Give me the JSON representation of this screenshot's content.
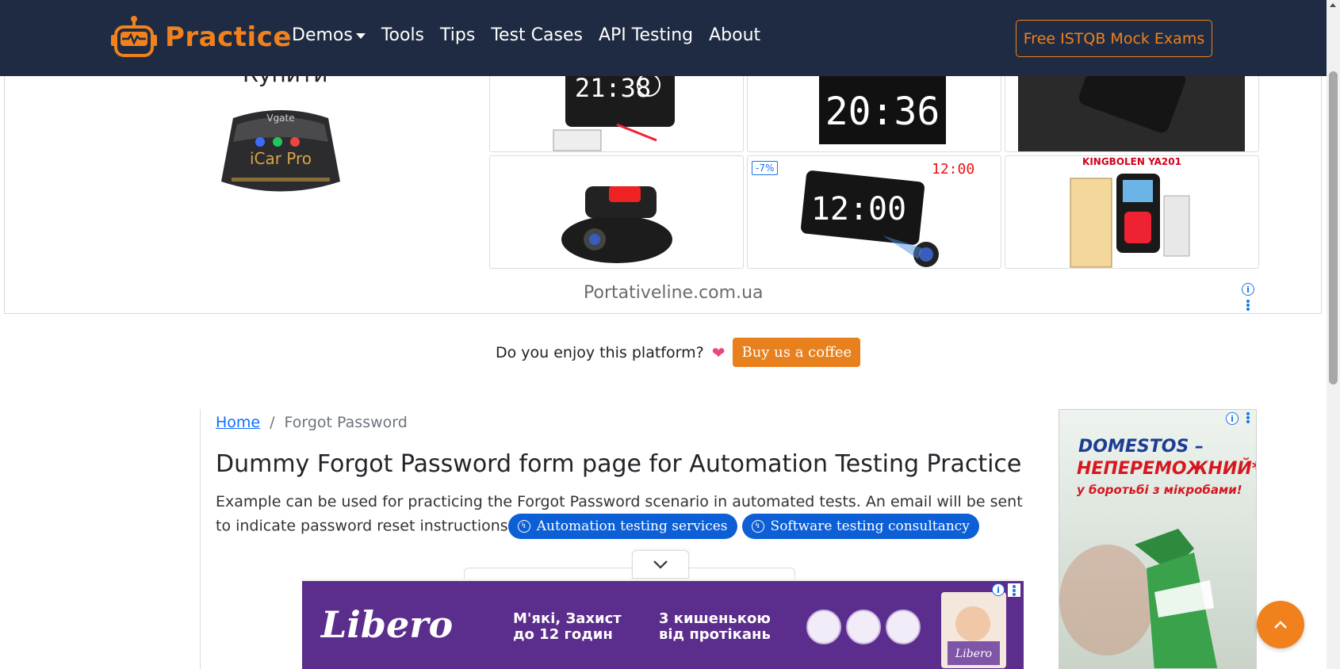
{
  "brand": {
    "name": "Practice",
    "color": "#f0811d"
  },
  "nav": {
    "items": [
      {
        "label": "Demos",
        "has_dropdown": true
      },
      {
        "label": "Tools"
      },
      {
        "label": "Tips"
      },
      {
        "label": "Test Cases"
      },
      {
        "label": "API Testing"
      },
      {
        "label": "About"
      }
    ],
    "cta_label": "Free ISTQB Mock Exams",
    "background": "#1e2b42"
  },
  "top_ad": {
    "heading": "Купити",
    "discount_badge": "-7%",
    "kingbolen_title": "KINGBOLEN YA201",
    "clock_text_1": "21:38",
    "clock_text_2": "20:36",
    "clock_text_3": "12:00",
    "domain": "Portativeline.com.ua",
    "obd_brand": "Vgate",
    "obd_product": "iCar Pro"
  },
  "coffee": {
    "text": "Do you enjoy this platform?",
    "heart_icon": "heart-icon",
    "button_label": "Buy us a coffee"
  },
  "breadcrumb": {
    "home": "Home",
    "separator": "/",
    "current": "Forgot Password"
  },
  "main": {
    "title": "Dummy Forgot Password form page for Automation Testing Practice",
    "description": "Example can be used for practicing the Forgot Password scenario in automated tests. An email will be sent to indicate password reset instructions",
    "pills": [
      {
        "label": "Automation testing services"
      },
      {
        "label": "Software testing consultancy"
      }
    ]
  },
  "bottom_ad": {
    "brand": "Libero",
    "claim_1_line_1": "М'які, Захист",
    "claim_1_line_2": "до 12 годин",
    "claim_2_line_1": "3 кишенькою",
    "claim_2_line_2": "від протікань"
  },
  "side_ad": {
    "line_1": "DOMESTOS –",
    "line_2": "НЕПЕРЕМОЖНИЙ*",
    "line_3": "у боротьбі з мікробами!"
  },
  "icons": {
    "to_top": "chevron-up-icon",
    "collapse": "chevron-down-icon",
    "ad_info": "info-icon"
  }
}
